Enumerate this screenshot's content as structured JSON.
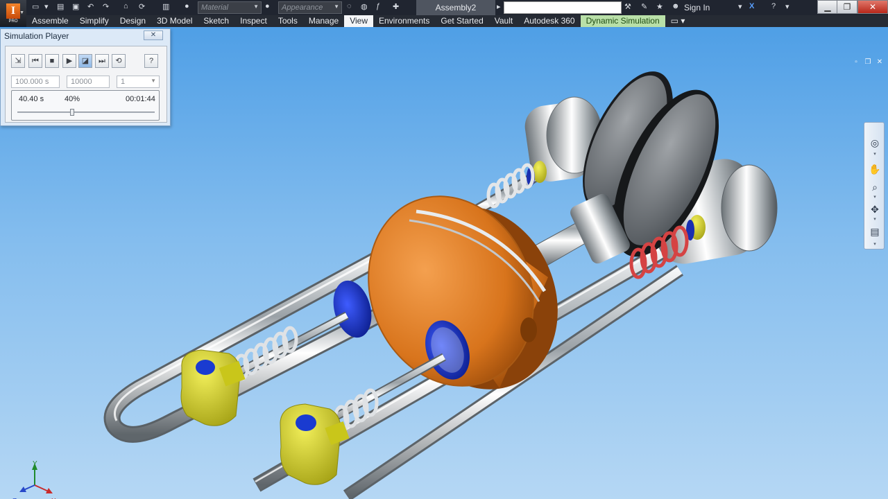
{
  "app": {
    "logo_letter": "I",
    "edition": "PRO"
  },
  "quick_access": {
    "material_placeholder": "Material",
    "appearance_placeholder": "Appearance"
  },
  "document": {
    "title": "Assembly2"
  },
  "user": {
    "sign_in_label": "Sign In"
  },
  "menu": {
    "tabs": [
      {
        "label": "Assemble"
      },
      {
        "label": "Simplify"
      },
      {
        "label": "Design"
      },
      {
        "label": "3D Model"
      },
      {
        "label": "Sketch"
      },
      {
        "label": "Inspect"
      },
      {
        "label": "Tools"
      },
      {
        "label": "Manage"
      },
      {
        "label": "View",
        "active": true
      },
      {
        "label": "Environments"
      },
      {
        "label": "Get Started"
      },
      {
        "label": "Vault"
      },
      {
        "label": "Autodesk 360"
      },
      {
        "label": "Dynamic Simulation",
        "contextual": true
      }
    ]
  },
  "sim_player": {
    "title": "Simulation Player",
    "close_label": "✕",
    "end_time": "100.000 s",
    "images": "10000",
    "filter": "1",
    "current_time": "40.40 s",
    "percent": "40%",
    "elapsed": "00:01:44",
    "progress": 0.4
  },
  "triad": {
    "x_label": "X",
    "y_label": "Y",
    "z_label": "Z"
  },
  "colors": {
    "accent_green_tab": "#b9e0a8",
    "piston": "#e07a1f",
    "shoe": "#d9d61e",
    "seal": "#1530c8",
    "red_spring": "#d23a3a"
  },
  "icons": {
    "nav": [
      "steering-wheel-icon",
      "pan-icon",
      "zoom-icon",
      "orbit-icon",
      "view-face-icon"
    ],
    "player": [
      "screen-capture-icon",
      "rewind-icon",
      "stop-icon",
      "play-icon",
      "record-icon",
      "end-icon",
      "loop-icon",
      "help-icon"
    ]
  }
}
